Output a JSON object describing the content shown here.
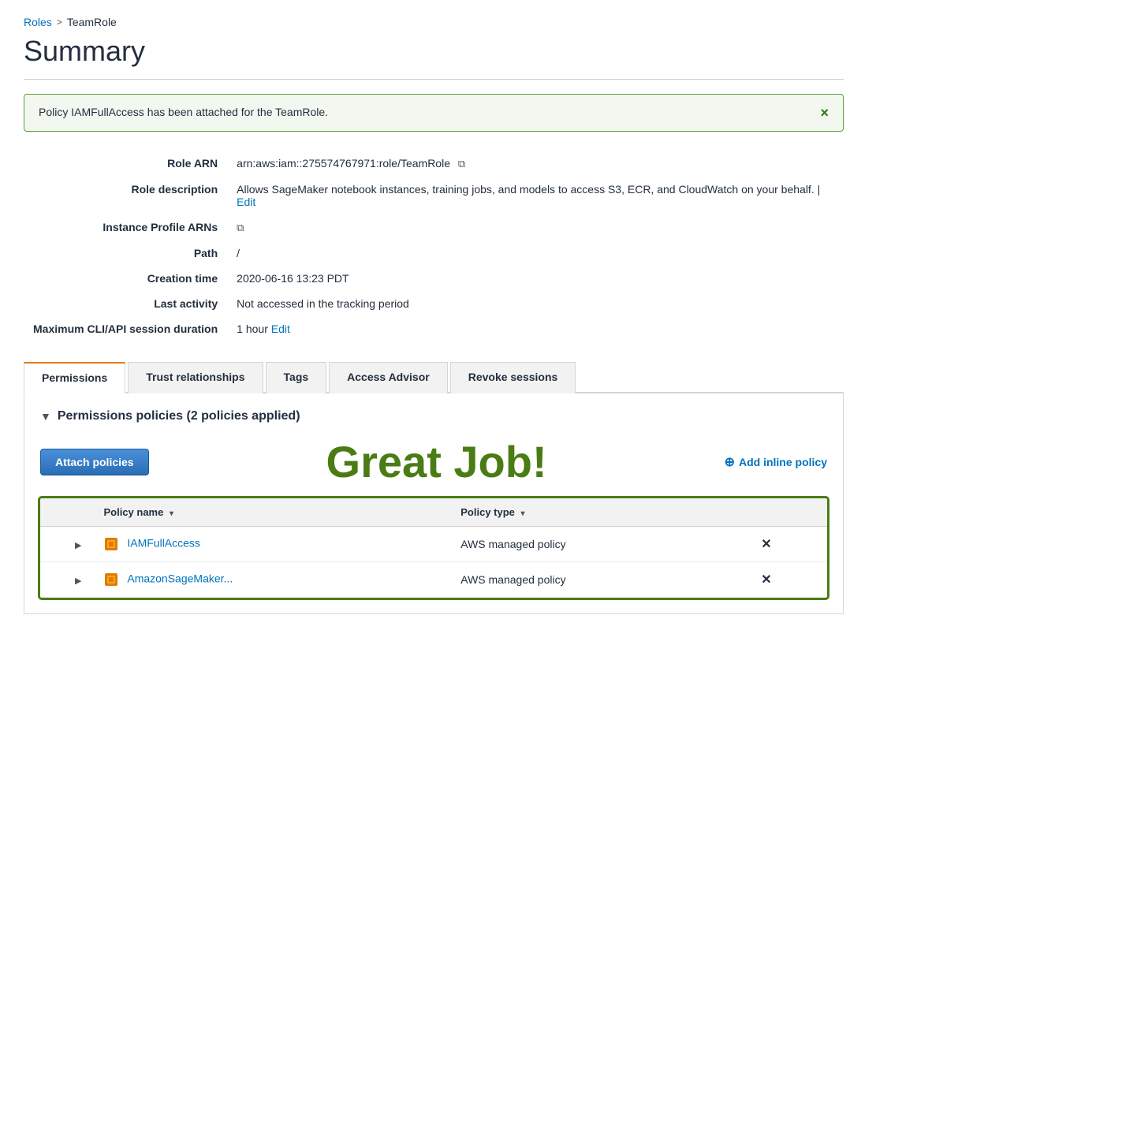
{
  "breadcrumb": {
    "roles_label": "Roles",
    "roles_href": "#",
    "separator": ">",
    "current": "TeamRole"
  },
  "page": {
    "title": "Summary"
  },
  "banner": {
    "message": "Policy IAMFullAccess has been attached for the TeamRole.",
    "close_label": "×"
  },
  "details": {
    "role_arn_label": "Role ARN",
    "role_arn_value": "arn:aws:iam::275574767971:role/TeamRole",
    "role_description_label": "Role description",
    "role_description_value": "Allows SageMaker notebook instances, training jobs, and models to access S3, ECR, and CloudWatch on your behalf.",
    "role_description_edit": "Edit",
    "instance_profile_label": "Instance Profile ARNs",
    "path_label": "Path",
    "path_value": "/",
    "creation_time_label": "Creation time",
    "creation_time_value": "2020-06-16 13:23 PDT",
    "last_activity_label": "Last activity",
    "last_activity_value": "Not accessed in the tracking period",
    "max_duration_label": "Maximum CLI/API session duration",
    "max_duration_value": "1 hour",
    "max_duration_edit": "Edit"
  },
  "tabs": [
    {
      "id": "permissions",
      "label": "Permissions",
      "active": true
    },
    {
      "id": "trust-relationships",
      "label": "Trust relationships",
      "active": false
    },
    {
      "id": "tags",
      "label": "Tags",
      "active": false
    },
    {
      "id": "access-advisor",
      "label": "Access Advisor",
      "active": false
    },
    {
      "id": "revoke-sessions",
      "label": "Revoke sessions",
      "active": false
    }
  ],
  "permissions": {
    "section_title": "Permissions policies (2 policies applied)",
    "attach_button_label": "Attach policies",
    "great_job_text": "Great Job!",
    "add_inline_label": "Add inline policy",
    "table_headers": [
      {
        "label": "Policy name",
        "sortable": true
      },
      {
        "label": "Policy type",
        "sortable": true
      }
    ],
    "policies": [
      {
        "name": "IAMFullAccess",
        "type": "AWS managed policy",
        "highlighted": true
      },
      {
        "name": "AmazonSageMaker...",
        "type": "AWS managed policy",
        "highlighted": true
      }
    ]
  },
  "icons": {
    "copy": "⧉",
    "plus_circle": "⊕",
    "expand_arrow": "▶",
    "sort_arrow": "▾",
    "collapse_arrow": "▼"
  },
  "colors": {
    "link_blue": "#0073bb",
    "success_green": "#4a7c14",
    "tab_orange": "#e07b00",
    "policy_icon_orange": "#e07b00",
    "policy_icon_light": "#f5a623"
  }
}
